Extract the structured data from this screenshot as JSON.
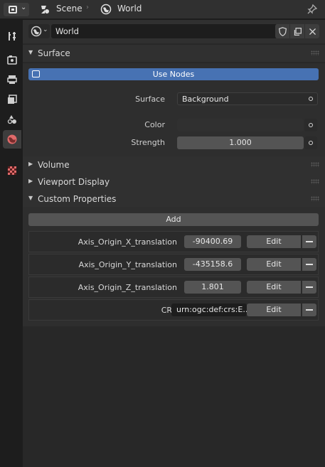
{
  "header": {
    "scene_label": "Scene",
    "world_label": "World"
  },
  "datablock": {
    "name": "World"
  },
  "panels": {
    "surface": "Surface",
    "volume": "Volume",
    "viewport_display": "Viewport Display",
    "custom_properties": "Custom Properties"
  },
  "surface": {
    "use_nodes_label": "Use Nodes",
    "surface_label": "Surface",
    "surface_value": "Background",
    "color_label": "Color",
    "strength_label": "Strength",
    "strength_value": "1.000"
  },
  "custom_properties": {
    "add_label": "Add",
    "edit_label": "Edit",
    "rows": [
      {
        "name": "Axis_Origin_X_translation",
        "value": "-90400.69"
      },
      {
        "name": "Axis_Origin_Y_translation",
        "value": "-435158.6"
      },
      {
        "name": "Axis_Origin_Z_translation",
        "value": "1.801"
      },
      {
        "name": "CRS",
        "value": "urn:ogc:def:crs:E.."
      }
    ]
  },
  "colors": {
    "accent": "#4772b3",
    "panel_bg": "#282828",
    "header_bg": "#303030"
  },
  "icons": [
    "editor-type-icon",
    "scene-icon",
    "world-icon",
    "pin-icon",
    "tool-icon",
    "render-icon",
    "output-icon",
    "view-layer-icon",
    "scene-properties-icon",
    "world-properties-icon",
    "texture-icon",
    "fake-user-shield-icon",
    "duplicate-icon",
    "unlink-icon"
  ]
}
